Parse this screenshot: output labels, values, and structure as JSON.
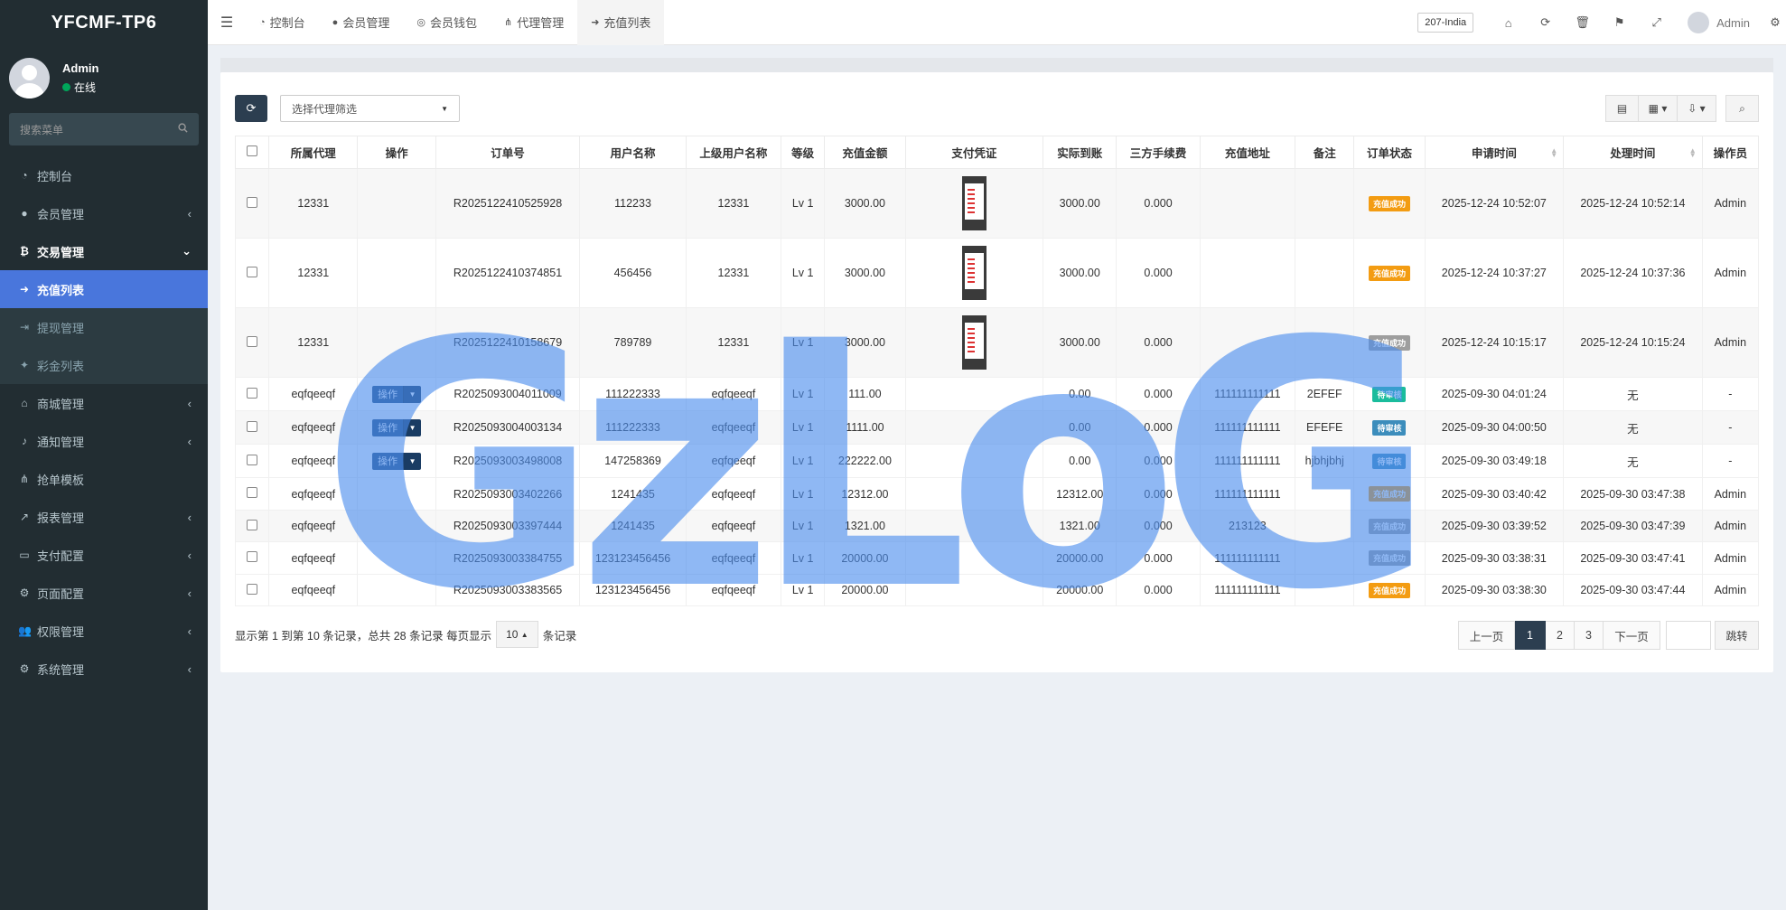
{
  "app": {
    "logo": "YFCMF-TP6"
  },
  "sidebar": {
    "user": {
      "name": "Admin",
      "status": "在线"
    },
    "search_placeholder": "搜索菜单",
    "items": [
      {
        "label": "控制台",
        "icon": "dashboard-icon",
        "arrow": ""
      },
      {
        "label": "会员管理",
        "icon": "user-icon",
        "arrow": "‹"
      },
      {
        "label": "交易管理",
        "icon": "bitcoin-icon",
        "arrow": "⌄"
      },
      {
        "label": "充值列表",
        "icon": "sign-in-icon",
        "arrow": ""
      },
      {
        "label": "提现管理",
        "icon": "sign-out-icon",
        "arrow": ""
      },
      {
        "label": "彩金列表",
        "icon": "gift-icon",
        "arrow": ""
      },
      {
        "label": "商城管理",
        "icon": "home-icon",
        "arrow": "‹"
      },
      {
        "label": "通知管理",
        "icon": "bell-icon",
        "arrow": "‹"
      },
      {
        "label": "抢单模板",
        "icon": "sitemap-icon",
        "arrow": ""
      },
      {
        "label": "报表管理",
        "icon": "line-chart-icon",
        "arrow": "‹"
      },
      {
        "label": "支付配置",
        "icon": "credit-card-icon",
        "arrow": "‹"
      },
      {
        "label": "页面配置",
        "icon": "cog-icon",
        "arrow": "‹"
      },
      {
        "label": "权限管理",
        "icon": "users-icon",
        "arrow": "‹"
      },
      {
        "label": "系统管理",
        "icon": "cogs-icon",
        "arrow": "‹"
      }
    ]
  },
  "topbar": {
    "tabs": [
      {
        "label": "控制台",
        "icon": "dashboard-icon"
      },
      {
        "label": "会员管理",
        "icon": "user-icon"
      },
      {
        "label": "会员钱包",
        "icon": "wallet-icon"
      },
      {
        "label": "代理管理",
        "icon": "sitemap-icon"
      },
      {
        "label": "充值列表",
        "icon": "sign-in-icon"
      }
    ],
    "country": "207-India",
    "admin": "Admin"
  },
  "toolbar": {
    "agent_select_placeholder": "选择代理筛选"
  },
  "table": {
    "headers": [
      "",
      "所属代理",
      "操作",
      "订单号",
      "用户名称",
      "上级用户名称",
      "等级",
      "充值金额",
      "支付凭证",
      "实际到账",
      "三方手续费",
      "充值地址",
      "备注",
      "订单状态",
      "申请时间",
      "处理时间",
      "操作员"
    ],
    "op_label": "操作",
    "rows": [
      {
        "agent": "12331",
        "op": false,
        "order": "R2025122410525928",
        "user": "112233",
        "parent": "12331",
        "level": "Lv 1",
        "amount": "3000.00",
        "receipt": true,
        "actual": "3000.00",
        "fee": "0.000",
        "address": "",
        "note": "",
        "status": "充值成功",
        "status_color": "#f39c12",
        "apply": "2025-12-24 10:52:07",
        "process": "2025-12-24 10:52:14",
        "operator": "Admin"
      },
      {
        "agent": "12331",
        "op": false,
        "order": "R2025122410374851",
        "user": "456456",
        "parent": "12331",
        "level": "Lv 1",
        "amount": "3000.00",
        "receipt": true,
        "actual": "3000.00",
        "fee": "0.000",
        "address": "",
        "note": "",
        "status": "充值成功",
        "status_color": "#f39c12",
        "apply": "2025-12-24 10:37:27",
        "process": "2025-12-24 10:37:36",
        "operator": "Admin"
      },
      {
        "agent": "12331",
        "op": false,
        "order": "R2025122410158679",
        "user": "789789",
        "parent": "12331",
        "level": "Lv 1",
        "amount": "3000.00",
        "receipt": true,
        "actual": "3000.00",
        "fee": "0.000",
        "address": "",
        "note": "",
        "status": "充值成功",
        "status_color": "#9e9e9e",
        "apply": "2025-12-24 10:15:17",
        "process": "2025-12-24 10:15:24",
        "operator": "Admin"
      },
      {
        "agent": "eqfqeeqf",
        "op": true,
        "order": "R2025093004011009",
        "user": "111222333",
        "parent": "eqfqeeqf",
        "level": "Lv 1",
        "amount": "111.00",
        "receipt": false,
        "actual": "0.00",
        "fee": "0.000",
        "address": "111111111111",
        "note": "2EFEF",
        "status": "待审核",
        "status_color": "#1abc9c",
        "apply": "2025-09-30 04:01:24",
        "process": "无",
        "operator": "-"
      },
      {
        "agent": "eqfqeeqf",
        "op": true,
        "order": "R2025093004003134",
        "user": "111222333",
        "parent": "eqfqeeqf",
        "level": "Lv 1",
        "amount": "1111.00",
        "receipt": false,
        "actual": "0.00",
        "fee": "0.000",
        "address": "111111111111",
        "note": "EFEFE",
        "status": "待审核",
        "status_color": "#3c8dbc",
        "apply": "2025-09-30 04:00:50",
        "process": "无",
        "operator": "-"
      },
      {
        "agent": "eqfqeeqf",
        "op": true,
        "order": "R2025093003498008",
        "user": "147258369",
        "parent": "eqfqeeqf",
        "level": "Lv 1",
        "amount": "222222.00",
        "receipt": false,
        "actual": "0.00",
        "fee": "0.000",
        "address": "111111111111",
        "note": "hjbhjbhj",
        "status": "待审核",
        "status_color": "#3c8dbc",
        "apply": "2025-09-30 03:49:18",
        "process": "无",
        "operator": "-"
      },
      {
        "agent": "eqfqeeqf",
        "op": false,
        "order": "R2025093003402266",
        "user": "1241435",
        "parent": "eqfqeeqf",
        "level": "Lv 1",
        "amount": "12312.00",
        "receipt": false,
        "actual": "12312.00",
        "fee": "0.000",
        "address": "111111111111",
        "note": "",
        "status": "充值成功",
        "status_color": "#f39c12",
        "apply": "2025-09-30 03:40:42",
        "process": "2025-09-30 03:47:38",
        "operator": "Admin"
      },
      {
        "agent": "eqfqeeqf",
        "op": false,
        "order": "R2025093003397444",
        "user": "1241435",
        "parent": "eqfqeeqf",
        "level": "Lv 1",
        "amount": "1321.00",
        "receipt": false,
        "actual": "1321.00",
        "fee": "0.000",
        "address": "213123",
        "note": "",
        "status": "充值成功",
        "status_color": "#9e9e9e",
        "apply": "2025-09-30 03:39:52",
        "process": "2025-09-30 03:47:39",
        "operator": "Admin"
      },
      {
        "agent": "eqfqeeqf",
        "op": false,
        "order": "R2025093003384755",
        "user": "123123456456",
        "parent": "eqfqeeqf",
        "level": "Lv 1",
        "amount": "20000.00",
        "receipt": false,
        "actual": "20000.00",
        "fee": "0.000",
        "address": "111111111111",
        "note": "",
        "status": "充值成功",
        "status_color": "#9e9e9e",
        "apply": "2025-09-30 03:38:31",
        "process": "2025-09-30 03:47:41",
        "operator": "Admin"
      },
      {
        "agent": "eqfqeeqf",
        "op": false,
        "order": "R2025093003383565",
        "user": "123123456456",
        "parent": "eqfqeeqf",
        "level": "Lv 1",
        "amount": "20000.00",
        "receipt": false,
        "actual": "20000.00",
        "fee": "0.000",
        "address": "111111111111",
        "note": "",
        "status": "充值成功",
        "status_color": "#f39c12",
        "apply": "2025-09-30 03:38:30",
        "process": "2025-09-30 03:47:44",
        "operator": "Admin"
      }
    ]
  },
  "pager": {
    "info_prefix": "显示第 1 到第 10 条记录，总共 28 条记录 每页显示",
    "page_size": "10",
    "info_suffix": "条记录",
    "prev": "上一页",
    "pages": [
      "1",
      "2",
      "3"
    ],
    "next": "下一页",
    "jump": "跳转"
  },
  "watermark": "GzLoG"
}
